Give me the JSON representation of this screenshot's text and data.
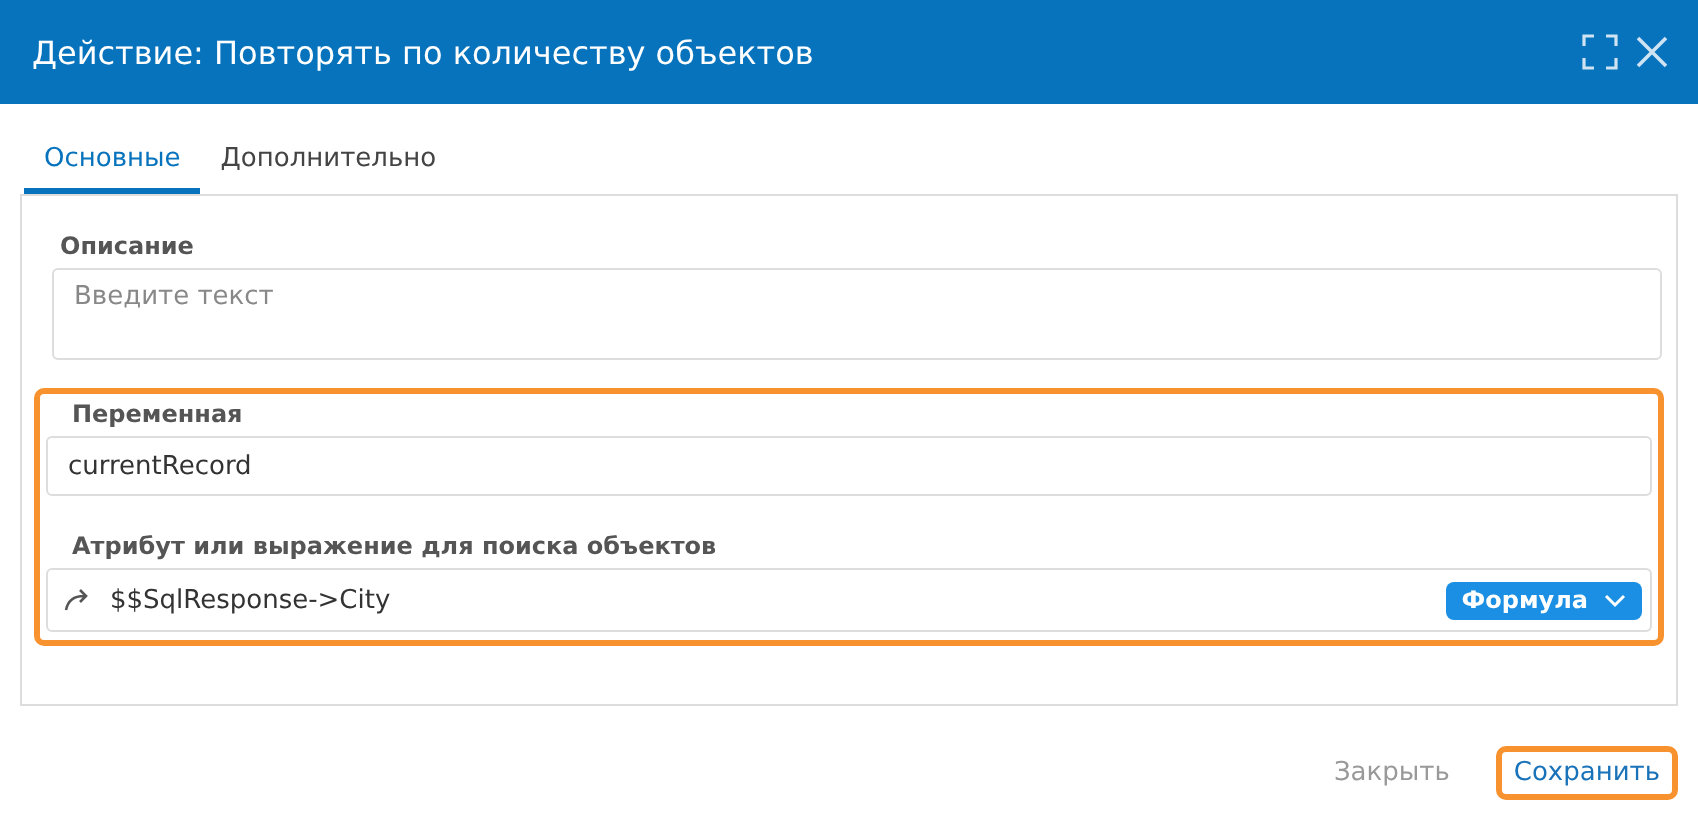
{
  "window": {
    "title": "Действие: Повторять по количеству объектов"
  },
  "tabs": [
    {
      "label": "Основные",
      "selected": true
    },
    {
      "label": "Дополнительно",
      "selected": false
    }
  ],
  "description": {
    "label": "Описание",
    "placeholder": "Введите текст"
  },
  "highlight_group": {
    "highlighted": true,
    "variable": {
      "label": "Переменная",
      "value": "currentRecord"
    },
    "attribute": {
      "label": "Атрибут или выражение для поиска объектов",
      "value": "$$SqlResponse->City",
      "mode": "Формула"
    }
  },
  "buttons": [
    {
      "label": "Закрыть",
      "kind": "secondary",
      "highlighted": false
    },
    {
      "label": "Сохранить",
      "kind": "primary",
      "highlighted": true
    }
  ]
}
